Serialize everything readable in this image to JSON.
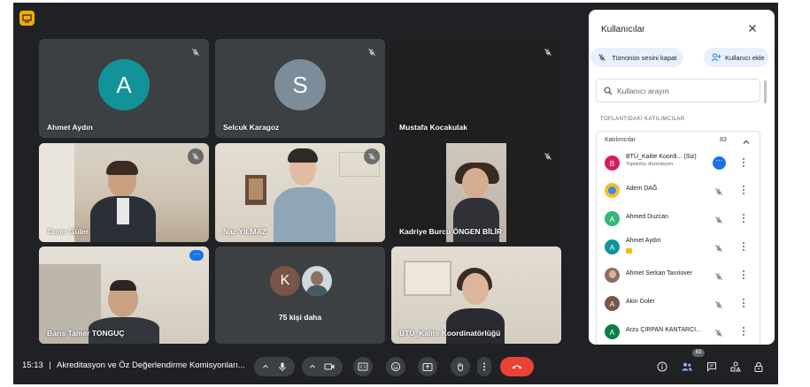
{
  "participants_tiles": [
    {
      "name": "Ahmet Aydın",
      "initial": "A",
      "color": "#12939a"
    },
    {
      "name": "Selcuk Karagoz",
      "initial": "S",
      "color": "#7c8c98"
    },
    {
      "name": "Mustafa Kocakulak"
    },
    {
      "name": "Taner Güler"
    },
    {
      "name": "Naz YILMAZ"
    },
    {
      "name": "Kadriye Burcu ÖNGEN BİLİR"
    },
    {
      "name": "Barış Tamer TONGUÇ"
    },
    {
      "name": "75 kişi daha",
      "initial": "K",
      "color": "#795548"
    },
    {
      "name": "BTÜ_Kalite Koordinatörlüğü"
    }
  ],
  "bottom_bar": {
    "time": "15:13",
    "separator": "|",
    "meeting_title": "Akreditasyon ve Öz Değerlendirme Komisyonları...",
    "people_count": "83",
    "accent_hangup": "#ea4335"
  },
  "panel": {
    "title": "Kullanıcılar",
    "mute_all_label": "Tümünün sesini kapat",
    "add_user_label": "Kullanıcı ekle",
    "search_placeholder": "Kullanıcı arayın",
    "section_title": "TOPLANTIDAKİ KATILIMCILAR",
    "group_label": "Katılımcılar",
    "group_count": "83",
    "people": [
      {
        "name": "BTÜ_Kalite Koordi...",
        "suffix": "(Siz)",
        "sub": "Toplantıyı düzenleyen",
        "initial": "B",
        "color": "#d81b60"
      },
      {
        "name": "Adem DAĞ",
        "initial": "",
        "color": "#f6bf26"
      },
      {
        "name": "Ahmed Duzcan",
        "initial": "A",
        "color": "#33b679"
      },
      {
        "name": "Ahmet Aydın",
        "initial": "A",
        "color": "#12939a"
      },
      {
        "name": "Ahmet Serkan Tanriover",
        "initial": "",
        "color": "#8d6e63"
      },
      {
        "name": "Akin Goler",
        "initial": "A",
        "color": "#795548"
      },
      {
        "name": "Arzu ÇIRPAN KANTARCI...",
        "initial": "A",
        "color": "#0b8043"
      }
    ]
  }
}
